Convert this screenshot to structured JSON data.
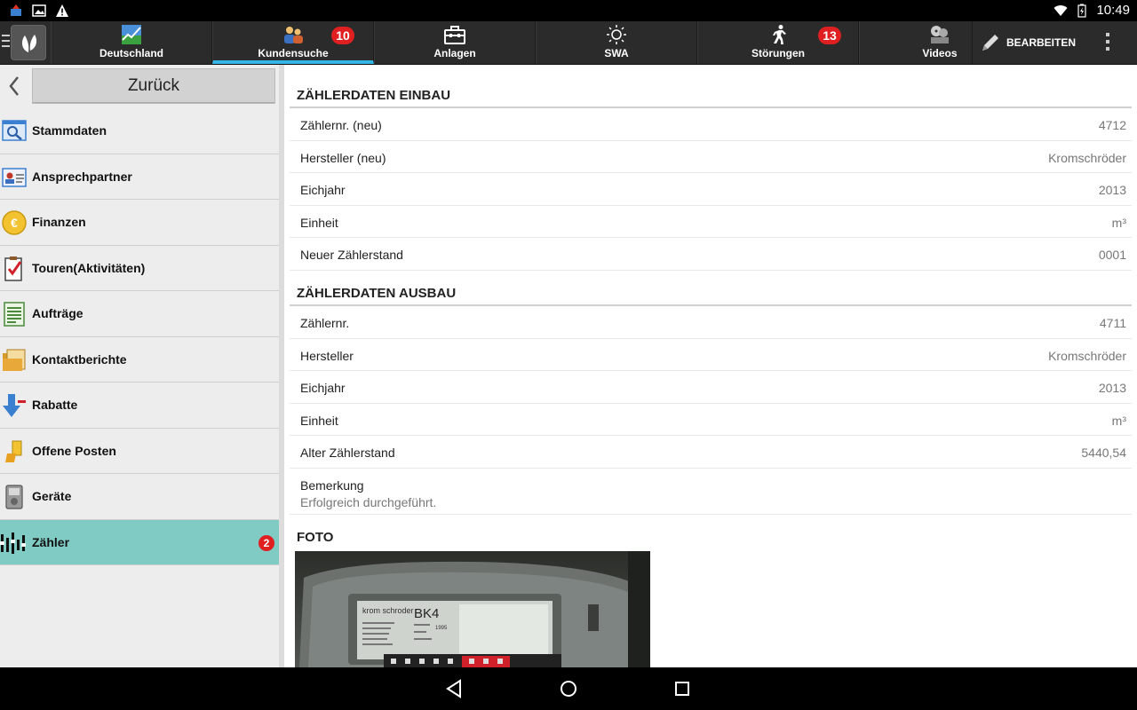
{
  "status_bar": {
    "time": "10:49",
    "icons": [
      "app-notification-icon",
      "image-icon",
      "warning-icon",
      "wifi-icon",
      "battery-icon"
    ]
  },
  "toolbar": {
    "tabs": [
      {
        "label": "Deutschland",
        "icon": "chart-icon"
      },
      {
        "label": "Kundensuche",
        "icon": "customers-icon",
        "badge": "10",
        "active": true
      },
      {
        "label": "Anlagen",
        "icon": "toolbox-icon"
      },
      {
        "label": "SWA",
        "icon": "sun-icon"
      },
      {
        "label": "Störungen",
        "icon": "running-man-icon",
        "badge": "13"
      },
      {
        "label": "Videos",
        "icon": "film-reel-icon"
      }
    ],
    "edit_label": "BEARBEITEN"
  },
  "sidebar": {
    "back_label": "Zurück",
    "items": [
      {
        "label": "Stammdaten",
        "icon": "magnifier-window-icon"
      },
      {
        "label": "Ansprechpartner",
        "icon": "contact-card-icon"
      },
      {
        "label": "Finanzen",
        "icon": "euro-coin-icon"
      },
      {
        "label": "Touren(Aktivitäten)",
        "icon": "checklist-icon"
      },
      {
        "label": "Aufträge",
        "icon": "document-list-icon"
      },
      {
        "label": "Kontaktberichte",
        "icon": "folder-icon"
      },
      {
        "label": "Rabatte",
        "icon": "arrow-down-icon"
      },
      {
        "label": "Offene Posten",
        "icon": "open-items-icon"
      },
      {
        "label": "Geräte",
        "icon": "device-icon"
      },
      {
        "label": "Zähler",
        "icon": "meter-icon",
        "badge": "2",
        "selected": true
      }
    ]
  },
  "main": {
    "einbau": {
      "title": "ZÄHLERDATEN EINBAU",
      "rows": [
        {
          "label": "Zählernr. (neu)",
          "value": "4712"
        },
        {
          "label": "Hersteller (neu)",
          "value": "Kromschröder"
        },
        {
          "label": "Eichjahr",
          "value": "2013"
        },
        {
          "label": "Einheit",
          "value": "m³"
        },
        {
          "label": "Neuer Zählerstand",
          "value": "0001"
        }
      ]
    },
    "ausbau": {
      "title": "ZÄHLERDATEN AUSBAU",
      "rows": [
        {
          "label": "Zählernr.",
          "value": "4711"
        },
        {
          "label": "Hersteller",
          "value": "Kromschröder"
        },
        {
          "label": "Eichjahr",
          "value": "2013"
        },
        {
          "label": "Einheit",
          "value": "m³"
        },
        {
          "label": "Alter Zählerstand",
          "value": "5440,54"
        }
      ],
      "remark_label": "Bemerkung",
      "remark_value": "Erfolgreich durchgeführt."
    },
    "foto": {
      "title": "FOTO",
      "meter_brand": "krom schroder",
      "meter_model": "BK4",
      "meter_year": "1995"
    }
  },
  "nav_bar": {
    "buttons": [
      "back-icon",
      "home-icon",
      "recents-icon"
    ]
  },
  "colors": {
    "accent": "#33b5e5",
    "selected_bg": "#80cbc4",
    "badge": "#e02020",
    "toolbar_bg": "#2b2b2b"
  }
}
